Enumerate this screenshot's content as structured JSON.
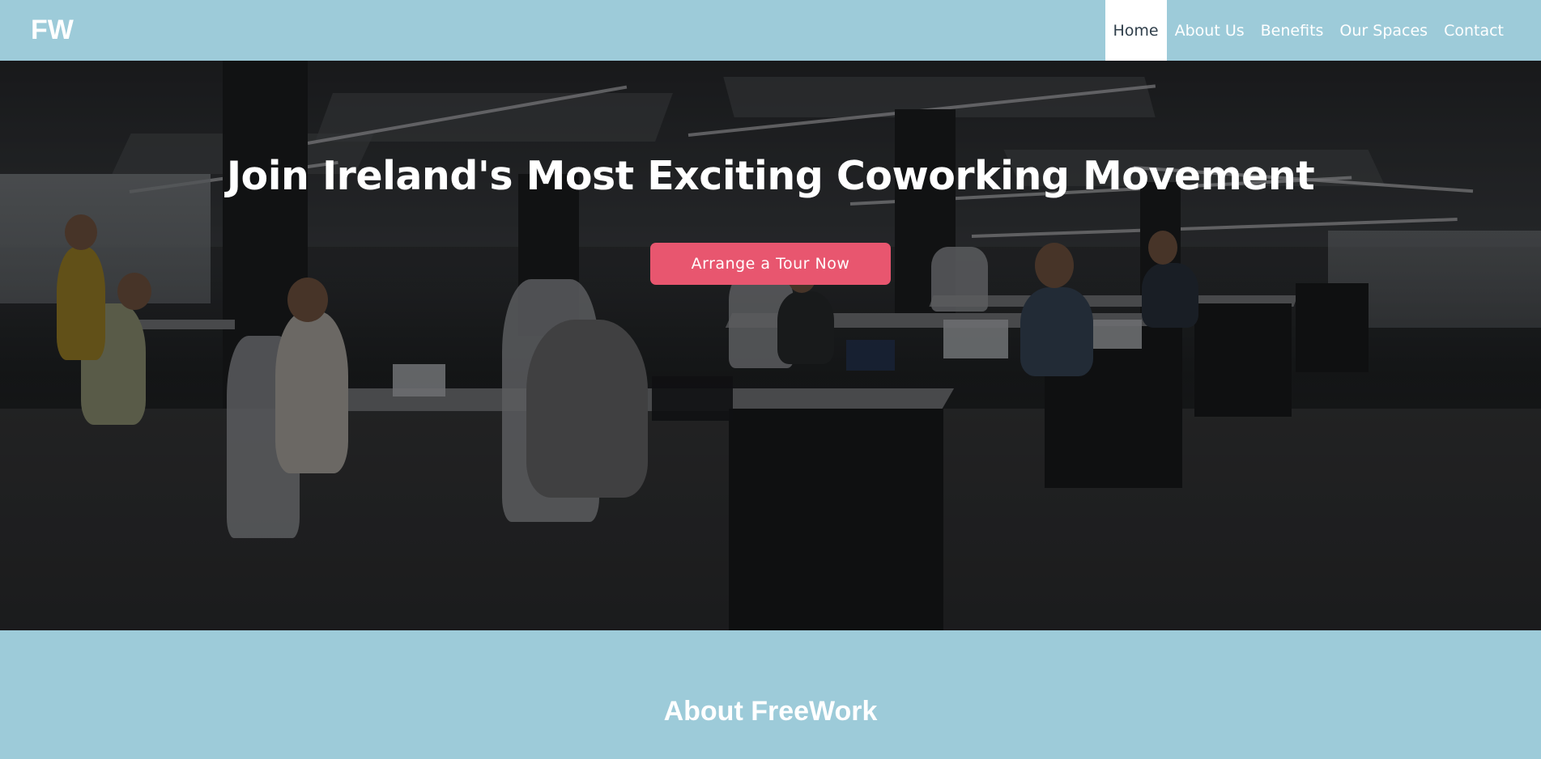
{
  "brand": {
    "logo": "FW"
  },
  "nav": {
    "items": [
      {
        "label": "Home",
        "active": true
      },
      {
        "label": "About Us",
        "active": false
      },
      {
        "label": "Benefits",
        "active": false
      },
      {
        "label": "Our Spaces",
        "active": false
      },
      {
        "label": "Contact",
        "active": false
      }
    ]
  },
  "hero": {
    "title": "Join Ireland's Most Exciting Coworking Movement",
    "cta_label": "Arrange a Tour Now",
    "image_description": "Open-plan coworking office with rows of desks and people working on laptops"
  },
  "about": {
    "title": "About FreeWork"
  },
  "colors": {
    "header_bg": "#9dcbd9",
    "accent": "#e8566f",
    "active_nav_bg": "#ffffff",
    "active_nav_text": "#2f3e4a",
    "text_light": "#ffffff"
  }
}
